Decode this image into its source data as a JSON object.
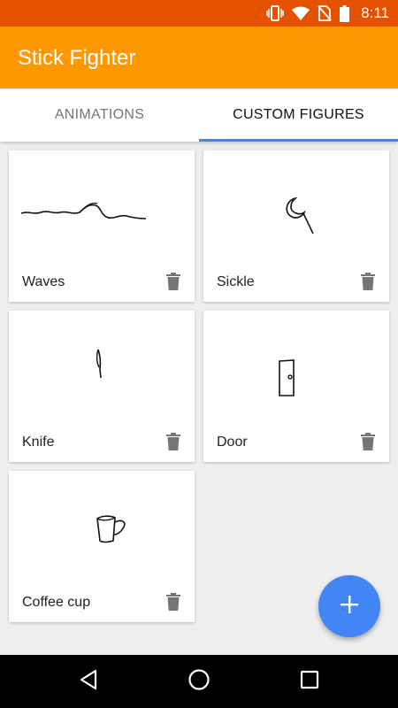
{
  "status_bar": {
    "time": "8:11",
    "icons": [
      "vibrate-icon",
      "wifi-icon",
      "no-sim-icon",
      "battery-icon"
    ]
  },
  "app_bar": {
    "title": "Stick Fighter"
  },
  "tabs": [
    {
      "label": "ANIMATIONS",
      "active": false
    },
    {
      "label": "CUSTOM FIGURES",
      "active": true
    }
  ],
  "figures": [
    {
      "name": "Waves",
      "drawing": "waves"
    },
    {
      "name": "Sickle",
      "drawing": "sickle"
    },
    {
      "name": "Knife",
      "drawing": "knife"
    },
    {
      "name": "Door",
      "drawing": "door"
    },
    {
      "name": "Coffee cup",
      "drawing": "coffee-cup"
    }
  ],
  "fab": {
    "icon": "plus-icon"
  },
  "nav_bar": {
    "icons": [
      "back-icon",
      "home-icon",
      "recents-icon"
    ]
  },
  "colors": {
    "status_bar": "#e65100",
    "app_bar": "#ff9800",
    "accent": "#4285f4",
    "tab_indicator": "#4285f4"
  }
}
